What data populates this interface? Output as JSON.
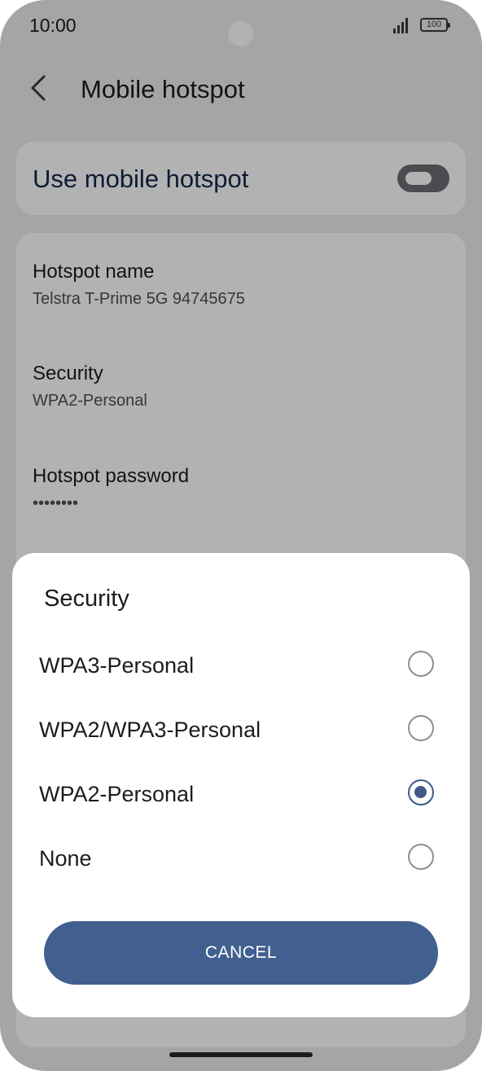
{
  "status": {
    "time": "10:00",
    "battery": "100"
  },
  "header": {
    "title": "Mobile hotspot"
  },
  "toggle": {
    "label": "Use mobile hotspot",
    "on": false
  },
  "settings": [
    {
      "label": "Hotspot name",
      "value": "Telstra T-Prime 5G 94745675"
    },
    {
      "label": "Security",
      "value": "WPA2-Personal"
    },
    {
      "label": "Hotspot password",
      "value": "••••••••"
    }
  ],
  "dialog": {
    "title": "Security",
    "options": [
      {
        "label": "WPA3-Personal",
        "selected": false
      },
      {
        "label": "WPA2/WPA3-Personal",
        "selected": false
      },
      {
        "label": "WPA2-Personal",
        "selected": true
      },
      {
        "label": "None",
        "selected": false
      }
    ],
    "cancel_label": "CANCEL"
  },
  "colors": {
    "accent": "#42608f",
    "radio_selected": "#3d5a8a",
    "toggle_label": "#14284b"
  }
}
